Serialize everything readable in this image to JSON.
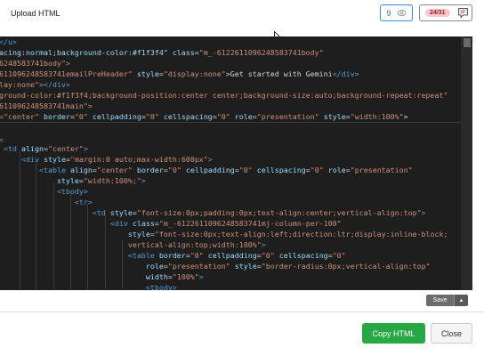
{
  "header": {
    "title": "Upload HTML",
    "views_count": "9",
    "comment_count": "24/31",
    "views_icon": "eye-icon",
    "comments_icon": "comment-list-icon"
  },
  "editor": {
    "lines": [
      [
        [
          "t",
          "</u>"
        ]
      ],
      [
        [
          "a",
          "acing:normal;background-color:#f1f3f4\" "
        ],
        [
          "a",
          "class"
        ],
        [
          "x",
          "="
        ],
        [
          "s",
          "\"m_-6122611096248583741body\""
        ]
      ],
      [
        [
          "s",
          "6248583741body\">"
        ]
      ],
      [
        [
          "s",
          "6110962485837​41emailPreHeader\" "
        ],
        [
          "a",
          "style"
        ],
        [
          "x",
          "="
        ],
        [
          "s",
          "\"display:none\""
        ],
        [
          "x",
          ">Get started with Gemini"
        ],
        [
          "t",
          "</div>"
        ]
      ],
      [
        [
          "s",
          "lay:none\">"
        ],
        [
          "t",
          "</div>"
        ]
      ],
      [
        [
          "s",
          "ground-color:#f1f3f4;background-position:center center;background-size:auto;background-repeat:repeat\""
        ]
      ],
      [
        [
          "s",
          "611096248583741main\">"
        ]
      ],
      [
        [
          "s",
          "=\"center\" "
        ],
        [
          "a",
          "border"
        ],
        [
          "x",
          "="
        ],
        [
          "s",
          "\"0\" "
        ],
        [
          "a",
          "cellpadding"
        ],
        [
          "x",
          "="
        ],
        [
          "s",
          "\"0\" "
        ],
        [
          "a",
          "cellspacing"
        ],
        [
          "x",
          "="
        ],
        [
          "s",
          "\"0\" "
        ],
        [
          "a",
          "role"
        ],
        [
          "x",
          "="
        ],
        [
          "s",
          "\"presentation\" "
        ],
        [
          "a",
          "style"
        ],
        [
          "x",
          "="
        ],
        [
          "s",
          "\"width:100%\""
        ],
        [
          "x",
          ">"
        ]
      ],
      [
        [
          "x",
          ""
        ]
      ],
      [
        [
          "t",
          "<"
        ]
      ],
      [
        [
          "x",
          " "
        ],
        [
          "t",
          "<td "
        ],
        [
          "a",
          "align"
        ],
        [
          "x",
          "="
        ],
        [
          "s",
          "\"center\""
        ],
        [
          "t",
          ">"
        ]
      ],
      [
        [
          "x",
          "     "
        ],
        [
          "t",
          "<div "
        ],
        [
          "a",
          "style"
        ],
        [
          "x",
          "="
        ],
        [
          "s",
          "\"margin:0 auto;max-width:600px\""
        ],
        [
          "t",
          ">"
        ]
      ],
      [
        [
          "x",
          "         "
        ],
        [
          "t",
          "<table "
        ],
        [
          "a",
          "align"
        ],
        [
          "x",
          "="
        ],
        [
          "s",
          "\"center\" "
        ],
        [
          "a",
          "border"
        ],
        [
          "x",
          "="
        ],
        [
          "s",
          "\"0\" "
        ],
        [
          "a",
          "cellpadding"
        ],
        [
          "x",
          "="
        ],
        [
          "s",
          "\"0\" "
        ],
        [
          "a",
          "cellspacing"
        ],
        [
          "x",
          "="
        ],
        [
          "s",
          "\"0\" "
        ],
        [
          "a",
          "role"
        ],
        [
          "x",
          "="
        ],
        [
          "s",
          "\"presentation\""
        ]
      ],
      [
        [
          "x",
          "             "
        ],
        [
          "a",
          "style"
        ],
        [
          "x",
          "="
        ],
        [
          "s",
          "\"width:100%;\""
        ],
        [
          "t",
          ">"
        ]
      ],
      [
        [
          "x",
          "             "
        ],
        [
          "t",
          "<tbody>"
        ]
      ],
      [
        [
          "x",
          "                 "
        ],
        [
          "t",
          "<tr>"
        ]
      ],
      [
        [
          "x",
          "                     "
        ],
        [
          "t",
          "<td "
        ],
        [
          "a",
          "style"
        ],
        [
          "x",
          "="
        ],
        [
          "s",
          "\"font-size:0px;padding:0px;text-align:center;vertical-align:top\""
        ],
        [
          "t",
          ">"
        ]
      ],
      [
        [
          "x",
          "                         "
        ],
        [
          "t",
          "<div "
        ],
        [
          "a",
          "class"
        ],
        [
          "x",
          "="
        ],
        [
          "s",
          "\"m_-6122611096248583741mj-column-per-100\""
        ]
      ],
      [
        [
          "x",
          "                             "
        ],
        [
          "a",
          "style"
        ],
        [
          "x",
          "="
        ],
        [
          "s",
          "\"font-size:0px;text-align:left;direction:ltr;display:inline-block;"
        ]
      ],
      [
        [
          "x",
          "                             "
        ],
        [
          "s",
          "vertical-align:top;width:100%\""
        ],
        [
          "t",
          ">"
        ]
      ],
      [
        [
          "x",
          "                             "
        ],
        [
          "t",
          "<table "
        ],
        [
          "a",
          "border"
        ],
        [
          "x",
          "="
        ],
        [
          "s",
          "\"0\" "
        ],
        [
          "a",
          "cellpadding"
        ],
        [
          "x",
          "="
        ],
        [
          "s",
          "\"0\" "
        ],
        [
          "a",
          "cellspacing"
        ],
        [
          "x",
          "="
        ],
        [
          "s",
          "\"0\""
        ]
      ],
      [
        [
          "x",
          "                                 "
        ],
        [
          "a",
          "role"
        ],
        [
          "x",
          "="
        ],
        [
          "s",
          "\"presentation\" "
        ],
        [
          "a",
          "style"
        ],
        [
          "x",
          "="
        ],
        [
          "s",
          "\"border-radius:0px;vertical-align:top\""
        ]
      ],
      [
        [
          "x",
          "                                 "
        ],
        [
          "a",
          "width"
        ],
        [
          "x",
          "="
        ],
        [
          "s",
          "\"100%\""
        ],
        [
          "t",
          ">"
        ]
      ],
      [
        [
          "x",
          "                                 "
        ],
        [
          "t",
          "<tbody>"
        ]
      ]
    ]
  },
  "save": {
    "label": "Save",
    "caret": "▲"
  },
  "footer": {
    "copy_label": "Copy HTML",
    "close_label": "Close"
  }
}
